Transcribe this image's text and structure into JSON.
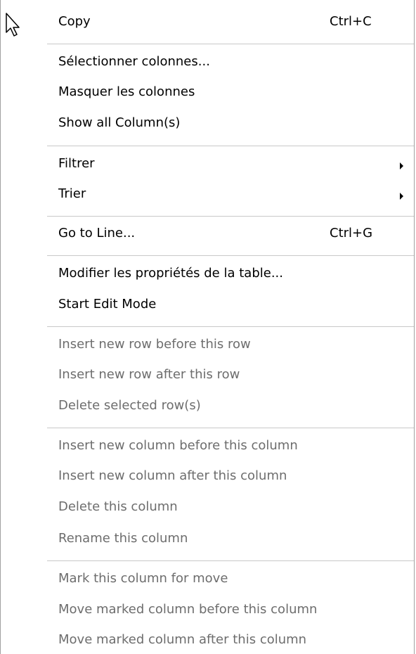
{
  "menu": {
    "copy": {
      "label": "Copy",
      "shortcut": "Ctrl+C"
    },
    "select_columns": {
      "label": "Sélectionner colonnes..."
    },
    "hide_columns": {
      "label": "Masquer les colonnes"
    },
    "show_all_columns": {
      "label": "Show all Column(s)"
    },
    "filter": {
      "label": "Filtrer"
    },
    "sort": {
      "label": "Trier"
    },
    "go_to_line": {
      "label": "Go to Line...",
      "shortcut": "Ctrl+G"
    },
    "modify_table_properties": {
      "label": "Modifier les propriétés de la table..."
    },
    "start_edit_mode": {
      "label": "Start Edit Mode"
    },
    "insert_row_before": {
      "label": "Insert new row before this row"
    },
    "insert_row_after": {
      "label": "Insert new row after this row"
    },
    "delete_selected_rows": {
      "label": "Delete selected row(s)"
    },
    "insert_column_before": {
      "label": "Insert new column before this column"
    },
    "insert_column_after": {
      "label": "Insert new column after this column"
    },
    "delete_column": {
      "label": "Delete this column"
    },
    "rename_column": {
      "label": "Rename this column"
    },
    "mark_column_move": {
      "label": "Mark this column for move"
    },
    "move_marked_before": {
      "label": "Move marked column before this column"
    },
    "move_marked_after": {
      "label": "Move marked column after this column"
    }
  },
  "icons": {
    "cursor": "arrow-cursor-icon",
    "submenu": "submenu-arrow-icon"
  },
  "colors": {
    "enabled_text": "#000000",
    "disabled_text": "#6d6d6d",
    "separator": "#c8c8c8",
    "border": "#a0a0a0"
  }
}
